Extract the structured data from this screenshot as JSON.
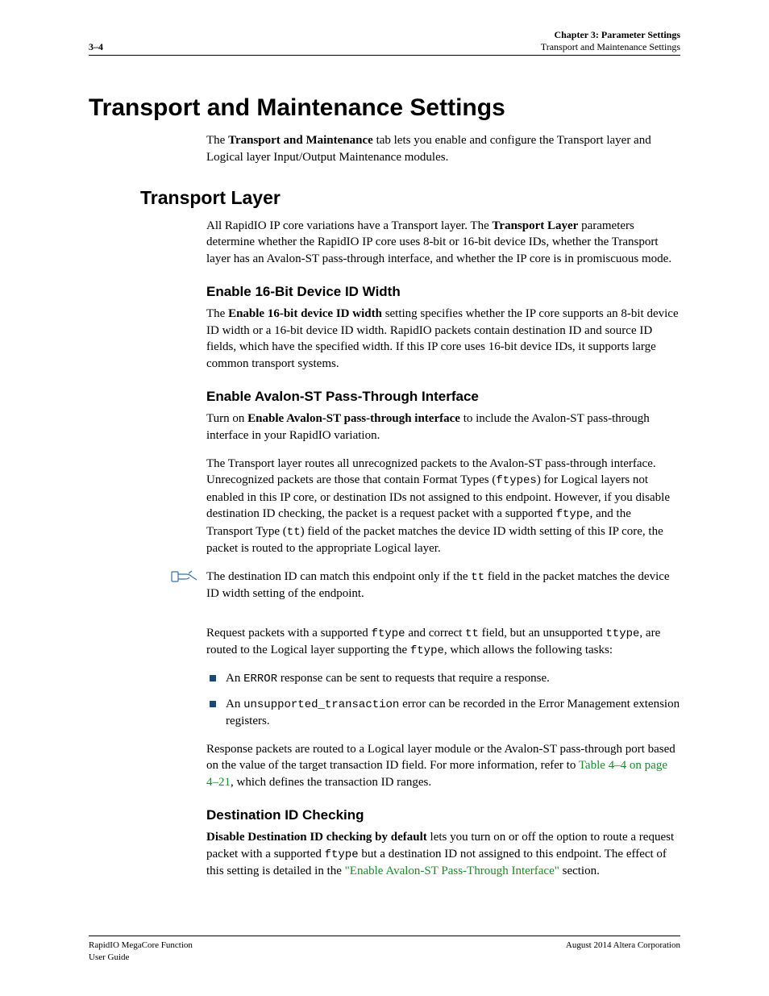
{
  "header": {
    "page_num": "3–4",
    "chapter": "Chapter 3:  Parameter Settings",
    "section": "Transport and Maintenance Settings"
  },
  "h1": "Transport and Maintenance Settings",
  "intro_1a": "The ",
  "intro_1b": "Transport and Maintenance",
  "intro_1c": " tab lets you enable and configure the Transport layer and Logical layer Input/Output Maintenance modules.",
  "h2_transport": "Transport Layer",
  "transport_p1a": "All RapidIO IP core variations have a Transport layer. The ",
  "transport_p1b": "Transport Layer",
  "transport_p1c": " parameters determine whether the RapidIO IP core uses 8-bit or 16-bit device IDs, whether the Transport layer has an Avalon-ST pass-through interface, and whether the IP core is in promiscuous mode.",
  "h3_enable16": "Enable 16-Bit Device ID Width",
  "en16_a": "The ",
  "en16_b": "Enable 16-bit device ID width",
  "en16_c": " setting specifies whether the IP core supports an 8-bit device ID width or a 16-bit device ID width. RapidIO packets contain destination ID and source ID fields, which have the specified width. If this IP core uses 16-bit device IDs, it supports large common transport systems.",
  "h3_avalon": "Enable Avalon-ST Pass-Through Interface",
  "av_p1a": "Turn on ",
  "av_p1b": "Enable Avalon-ST pass-through interface",
  "av_p1c": " to include the Avalon-ST pass-through interface in your RapidIO variation.",
  "av_p2a": "The Transport layer routes all unrecognized packets to the Avalon-ST pass-through interface. Unrecognized packets are those that contain Format Types (",
  "av_p2b": "ftypes",
  "av_p2c": ") for Logical layers not enabled in this IP core, or destination IDs not assigned to this endpoint. However, if you disable destination ID checking, the packet is a request packet with a supported ",
  "av_p2d": "ftype",
  "av_p2e": ", and the Transport Type (",
  "av_p2f": "tt",
  "av_p2g": ") field of the packet matches the device ID width setting of this IP core, the packet is routed to the appropriate Logical layer.",
  "note_a": "The destination ID can match this endpoint only if the ",
  "note_b": "tt",
  "note_c": " field in the packet matches the device ID width setting of the endpoint.",
  "req_a": "Request packets with a supported ",
  "req_b": "ftype",
  "req_c": " and correct ",
  "req_d": "tt",
  "req_e": " field, but an unsupported ",
  "req_f": "ttype",
  "req_g": ", are routed to the Logical layer supporting the ",
  "req_h": "ftype",
  "req_i": ", which allows the following tasks:",
  "bullet1a": "An ",
  "bullet1b": "ERROR",
  "bullet1c": " response can be sent to requests that require a response.",
  "bullet2a": "An ",
  "bullet2b": "unsupported_transaction",
  "bullet2c": " error can be recorded in the Error Management extension registers.",
  "resp_a": "Response packets are routed to a Logical layer module or the Avalon-ST pass-through port based on the value of the target transaction ID field. For more information, refer to ",
  "resp_link": "Table 4–4 on page 4–21",
  "resp_b": ", which defines the transaction ID ranges.",
  "h3_dest": "Destination ID Checking",
  "dest_a": "Disable Destination ID checking by default",
  "dest_b": " lets you turn on or off the option to route a request packet with a supported ",
  "dest_c": "ftype",
  "dest_d": " but a destination ID not assigned to this endpoint. The effect of this setting is detailed in the ",
  "dest_link": "\"Enable Avalon-ST Pass-Through Interface\"",
  "dest_e": " section.",
  "footer": {
    "left1": "RapidIO MegaCore Function",
    "left2": "User Guide",
    "right": "August 2014   Altera Corporation"
  }
}
